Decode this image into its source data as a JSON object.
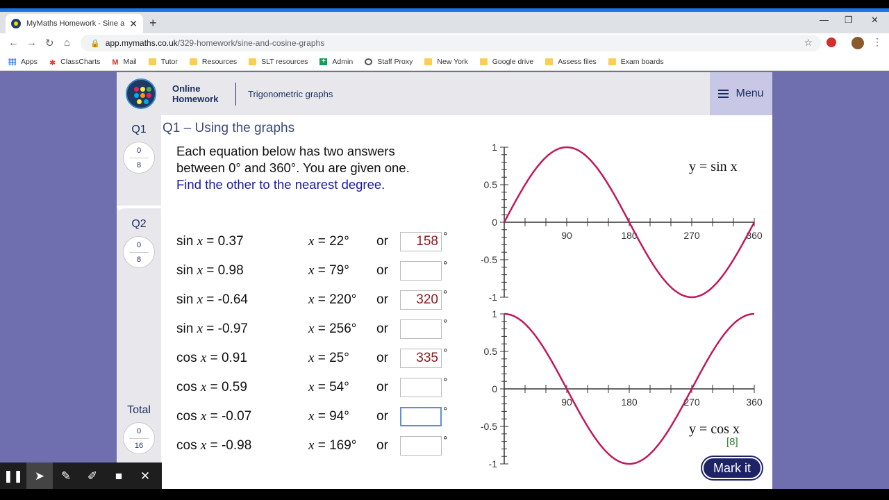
{
  "browser": {
    "tab_title": "MyMaths Homework - Sine and",
    "url_host": "app.mymaths.co.uk",
    "url_path": "/329-homework/sine-and-cosine-graphs",
    "bookmarks": [
      "Apps",
      "ClassCharts",
      "Mail",
      "Tutor",
      "Resources",
      "SLT resources",
      "Admin",
      "Staff Proxy",
      "New York",
      "Google drive",
      "Assess files",
      "Exam boards"
    ]
  },
  "header": {
    "brand_line1": "Online",
    "brand_line2": "Homework",
    "breadcrumb": "Trigonometric graphs",
    "menu_label": "Menu"
  },
  "nav": {
    "q1": {
      "label": "Q1",
      "score": "0",
      "max": "8"
    },
    "q2": {
      "label": "Q2",
      "score": "0",
      "max": "8"
    },
    "total": {
      "label": "Total",
      "score": "0",
      "max": "16"
    }
  },
  "question": {
    "title": "Q1 – Using the graphs",
    "intro_line1": "Each equation below has two answers",
    "intro_line2": "between 0° and 360°. You are given one.",
    "intro_line3": "Find the other to the nearest degree.",
    "or_label": "or",
    "degree_symbol": "°",
    "rows": [
      {
        "fn": "sin",
        "rhs": "= 0.37",
        "given": "22°",
        "answer": "158"
      },
      {
        "fn": "sin",
        "rhs": "= 0.98",
        "given": "79°",
        "answer": ""
      },
      {
        "fn": "sin",
        "rhs": "= -0.64",
        "given": "220°",
        "answer": "320"
      },
      {
        "fn": "sin",
        "rhs": "= -0.97",
        "given": "256°",
        "answer": ""
      },
      {
        "fn": "cos",
        "rhs": "= 0.91",
        "given": "25°",
        "answer": "335"
      },
      {
        "fn": "cos",
        "rhs": "= 0.59",
        "given": "54°",
        "answer": ""
      },
      {
        "fn": "cos",
        "rhs": "= -0.07",
        "given": "94°",
        "answer": ""
      },
      {
        "fn": "cos",
        "rhs": "= -0.98",
        "given": "169°",
        "answer": ""
      }
    ],
    "marks": "[8]",
    "mark_button": "Mark it"
  },
  "chart_data": [
    {
      "type": "line",
      "title": "y = sin x",
      "x_ticks": [
        90,
        180,
        270,
        360
      ],
      "y_ticks": [
        1,
        0.5,
        0,
        -0.5,
        -1
      ],
      "xlim": [
        0,
        360
      ],
      "ylim": [
        -1,
        1
      ],
      "series": [
        {
          "name": "y = sin x",
          "function": "sin",
          "color": "#c2185b"
        }
      ]
    },
    {
      "type": "line",
      "title": "y = cos x",
      "x_ticks": [
        90,
        180,
        270,
        360
      ],
      "y_ticks": [
        1,
        0.5,
        0,
        -0.5,
        -1
      ],
      "xlim": [
        0,
        360
      ],
      "ylim": [
        -1,
        1
      ],
      "series": [
        {
          "name": "y = cos x",
          "function": "cos",
          "color": "#c2185b"
        }
      ]
    }
  ]
}
